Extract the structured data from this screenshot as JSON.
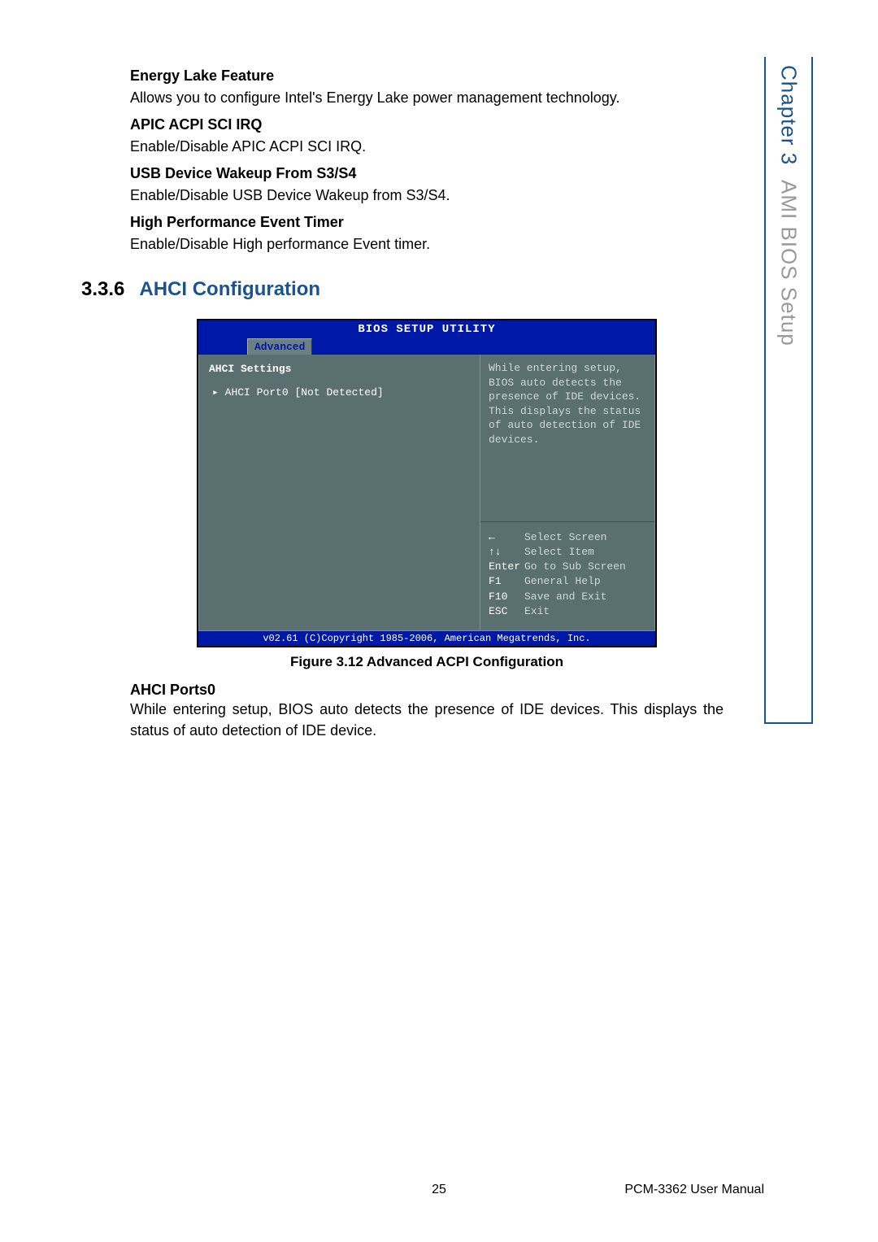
{
  "sideTab": {
    "chapter": "Chapter 3",
    "title": "AMI BIOS Setup"
  },
  "features": [
    {
      "title": "Energy Lake Feature",
      "desc": "Allows you to configure Intel's Energy Lake power management technology."
    },
    {
      "title": "APIC ACPI SCI IRQ",
      "desc": "Enable/Disable APIC ACPI SCI IRQ."
    },
    {
      "title": "USB Device Wakeup From S3/S4",
      "desc": "Enable/Disable USB Device Wakeup from S3/S4."
    },
    {
      "title": "High Performance Event Timer",
      "desc": "Enable/Disable High performance Event timer."
    }
  ],
  "section": {
    "number": "3.3.6",
    "title": "AHCI Configuration"
  },
  "bios": {
    "titleBar": "BIOS SETUP UTILITY",
    "tab": "Advanced",
    "leftTitle": "AHCI Settings",
    "leftItem": "AHCI Port0 [Not Detected]",
    "helpTop": "While entering setup, BIOS auto detects the presence of IDE devices. This displays the status of auto detection of IDE devices.",
    "helpKeys": [
      {
        "key": "←",
        "label": "Select Screen"
      },
      {
        "key": "↑↓",
        "label": "Select Item"
      },
      {
        "key": "Enter",
        "label": "Go to Sub Screen"
      },
      {
        "key": "F1",
        "label": "General Help"
      },
      {
        "key": "F10",
        "label": "Save and Exit"
      },
      {
        "key": "ESC",
        "label": "Exit"
      }
    ],
    "footer": "v02.61 (C)Copyright 1985-2006, American Megatrends, Inc."
  },
  "figureCaption": "Figure 3.12 Advanced ACPI Configuration",
  "subHeading": "AHCI Ports0",
  "subDesc": "While entering setup, BIOS auto detects the presence of IDE devices. This displays the status of auto detection of IDE device.",
  "footer": {
    "pageNum": "25",
    "manual": "PCM-3362 User Manual"
  }
}
